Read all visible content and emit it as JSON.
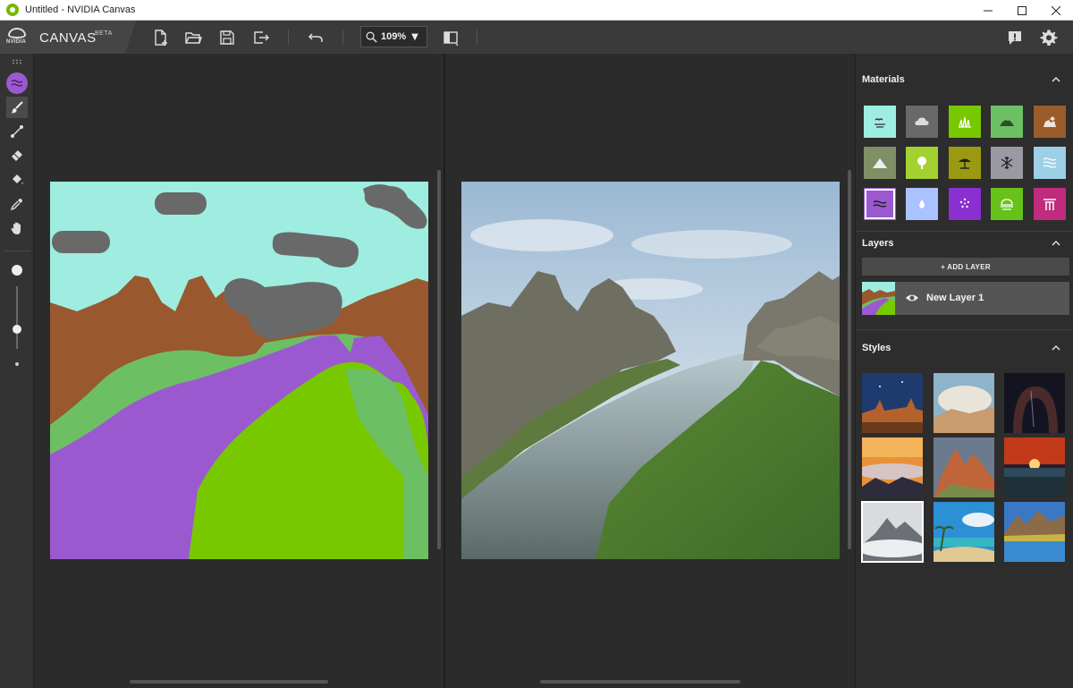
{
  "window": {
    "title": "Untitled - NVIDIA Canvas",
    "controls": [
      "minimize-icon",
      "maximize-icon",
      "close-icon"
    ]
  },
  "toolbar": {
    "brand_name": "CANVAS",
    "brand_tag": "BETA",
    "logo_text": "NVIDIA",
    "buttons": [
      "new-file-icon",
      "open-folder-icon",
      "save-icon",
      "export-icon",
      "undo-icon",
      "search-icon",
      "compare-view-icon",
      "feedback-icon",
      "gear-icon"
    ],
    "zoom_value": "109%"
  },
  "tools": {
    "items": [
      "material-swatch",
      "brush-icon",
      "line-icon",
      "eraser-icon",
      "fill-bucket-icon",
      "eyedropper-icon",
      "hand-icon"
    ],
    "active": "brush-icon",
    "current_material_color": "#9b59d0"
  },
  "panel": {
    "materials": {
      "title": "Materials",
      "selected": "river",
      "items": [
        {
          "name": "sky",
          "color": "#9eede0",
          "icon": "sky-birds-icon"
        },
        {
          "name": "cloud",
          "color": "#696969",
          "icon": "cloud-icon"
        },
        {
          "name": "grass",
          "color": "#78c800",
          "icon": "grass-icon"
        },
        {
          "name": "hill",
          "color": "#6dbf63",
          "icon": "hill-icon"
        },
        {
          "name": "rock",
          "color": "#9a5c2b",
          "icon": "rock-icon"
        },
        {
          "name": "mountain",
          "color": "#7f9066",
          "icon": "mountain-icon"
        },
        {
          "name": "tree",
          "color": "#a3d130",
          "icon": "tree-icon"
        },
        {
          "name": "sand",
          "color": "#9a9a12",
          "icon": "beach-umbrella-icon"
        },
        {
          "name": "snow",
          "color": "#9a9aa2",
          "icon": "snowflake-icon"
        },
        {
          "name": "sea",
          "color": "#9dd0e6",
          "icon": "waves-icon"
        },
        {
          "name": "river",
          "color": "#9b59d0",
          "icon": "river-icon"
        },
        {
          "name": "water",
          "color": "#aac2ff",
          "icon": "water-drop-icon"
        },
        {
          "name": "flower",
          "color": "#8a2fd0",
          "icon": "flower-icon"
        },
        {
          "name": "fog",
          "color": "#66c21a",
          "icon": "fog-icon"
        },
        {
          "name": "building",
          "color": "#c02b7e",
          "icon": "building-icon"
        }
      ]
    },
    "layers": {
      "title": "Layers",
      "add_label": "+ ADD LAYER",
      "items": [
        {
          "name": "New Layer 1",
          "visible": true
        }
      ]
    },
    "styles": {
      "title": "Styles",
      "selected_index": 6,
      "items": [
        "style-desert-night",
        "style-cloudy-cliffs",
        "style-night-arch",
        "style-sunset-fog",
        "style-red-peaks",
        "style-red-sunset",
        "style-misty-peak",
        "style-tropical-beach",
        "style-alpine-lake"
      ]
    }
  }
}
